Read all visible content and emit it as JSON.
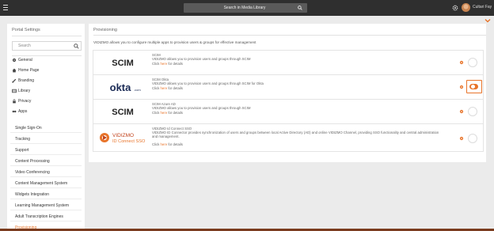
{
  "topbar": {
    "search_placeholder": "Search in Media Library",
    "user_name": "Cultari Fay"
  },
  "sidebar": {
    "title": "Portal Settings",
    "search_placeholder": "Search",
    "nav": [
      "General",
      "Home Page",
      "Branding",
      "Library",
      "Privacy",
      "Apps"
    ],
    "subnav": [
      "Single Sign-On",
      "Tracking",
      "Support",
      "Content Processing",
      "Video Conferencing",
      "Content Management System",
      "Widgets Integration",
      "Learning Management System",
      "Adult Transcription Engines",
      "Provisioning"
    ],
    "active_subnav": "Provisioning"
  },
  "panel": {
    "title": "Provisioning",
    "description": "VIDIZMO allows you to configure multiple apps to provision users & groups for effective management",
    "click_prefix": "Click ",
    "click_link": "here",
    "click_suffix": " for details",
    "apps": [
      {
        "logo": "SCIM",
        "name": "SCIM",
        "desc": "VIDIZMO allows you to provision users and groups through SCIM",
        "enabled": false
      },
      {
        "logo": "okta",
        "logo_sub": ".com",
        "name": "SCIM Okta",
        "desc": "VIDIZMO allows you to provision users and groups through SCIM for Okta",
        "enabled": true
      },
      {
        "logo": "SCIM",
        "name": "SCIM Azure AD",
        "desc": "VIDIZMO allows you to provision users and groups through SCIM",
        "enabled": false
      },
      {
        "logo": "VIDIZMO",
        "logo_sub": "ID Connect SSO",
        "name": "VIDIZMO Id Connect SSO",
        "desc": "VIDIZMO ID Connector provides synchronization of users and groups between local Active Directory (AD) and online VIDIZMO Channel, providing SSO functionality and central administration and management.",
        "enabled": false
      }
    ]
  },
  "colors": {
    "accent": "#e8742a",
    "topbar": "#2f2f2f",
    "page_bg": "#ebebeb"
  }
}
